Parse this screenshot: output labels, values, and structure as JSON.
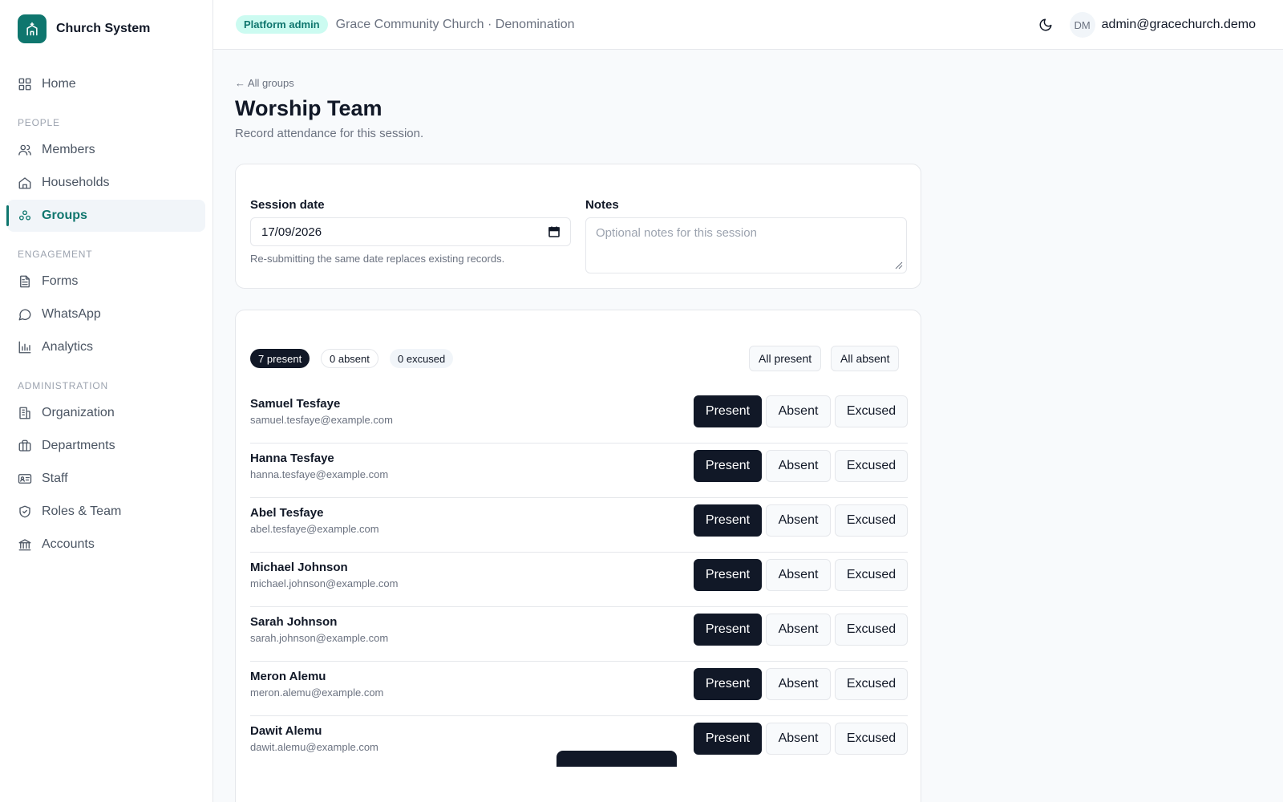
{
  "brand": {
    "name": "Church System",
    "icon": "church-icon"
  },
  "sidebar": {
    "items": [
      {
        "type": "item",
        "label": "Home",
        "icon": "grid-icon",
        "name": "sidebar-item-home"
      },
      {
        "type": "section",
        "label": "PEOPLE"
      },
      {
        "type": "item",
        "label": "Members",
        "icon": "users-icon",
        "name": "sidebar-item-members"
      },
      {
        "type": "item",
        "label": "Households",
        "icon": "house-icon",
        "name": "sidebar-item-households"
      },
      {
        "type": "item",
        "label": "Groups",
        "icon": "groups-icon",
        "name": "sidebar-item-groups",
        "active": true
      },
      {
        "type": "section",
        "label": "ENGAGEMENT"
      },
      {
        "type": "item",
        "label": "Forms",
        "icon": "document-icon",
        "name": "sidebar-item-forms"
      },
      {
        "type": "item",
        "label": "WhatsApp",
        "icon": "chat-icon",
        "name": "sidebar-item-whatsapp"
      },
      {
        "type": "item",
        "label": "Analytics",
        "icon": "bar-chart-icon",
        "name": "sidebar-item-analytics"
      },
      {
        "type": "section",
        "label": "ADMINISTRATION"
      },
      {
        "type": "item",
        "label": "Organization",
        "icon": "building-icon",
        "name": "sidebar-item-organization"
      },
      {
        "type": "item",
        "label": "Departments",
        "icon": "briefcase-icon",
        "name": "sidebar-item-departments"
      },
      {
        "type": "item",
        "label": "Staff",
        "icon": "id-card-icon",
        "name": "sidebar-item-staff"
      },
      {
        "type": "item",
        "label": "Roles & Team",
        "icon": "shield-icon",
        "name": "sidebar-item-roles-team"
      },
      {
        "type": "item",
        "label": "Accounts",
        "icon": "bank-icon",
        "name": "sidebar-item-accounts"
      }
    ]
  },
  "header": {
    "badge": "Platform admin",
    "org": "Grace Community Church · Denomination",
    "theme_icon": "moon-icon",
    "avatar_initials": "DM",
    "user_email": "admin@gracechurch.demo"
  },
  "page": {
    "back_link": "← All groups",
    "title": "Worship Team",
    "subtitle": "Record attendance for this session."
  },
  "session": {
    "date_label": "Session date",
    "date_value": "17/09/2026",
    "date_hint": "Re-submitting the same date replaces existing records.",
    "notes_label": "Notes",
    "notes_placeholder": "Optional notes for this session"
  },
  "attendance": {
    "counts": {
      "present": "7 present",
      "absent": "0 absent",
      "excused": "0 excused"
    },
    "bulk": {
      "all_present": "All present",
      "all_absent": "All absent"
    },
    "status_labels": {
      "present": "Present",
      "absent": "Absent",
      "excused": "Excused"
    },
    "members": [
      {
        "name": "Samuel Tesfaye",
        "email": "samuel.tesfaye@example.com",
        "status": "present"
      },
      {
        "name": "Hanna Tesfaye",
        "email": "hanna.tesfaye@example.com",
        "status": "present"
      },
      {
        "name": "Abel Tesfaye",
        "email": "abel.tesfaye@example.com",
        "status": "present"
      },
      {
        "name": "Michael Johnson",
        "email": "michael.johnson@example.com",
        "status": "present"
      },
      {
        "name": "Sarah Johnson",
        "email": "sarah.johnson@example.com",
        "status": "present"
      },
      {
        "name": "Meron Alemu",
        "email": "meron.alemu@example.com",
        "status": "present"
      },
      {
        "name": "Dawit Alemu",
        "email": "dawit.alemu@example.com",
        "status": "present"
      }
    ]
  },
  "colors": {
    "accent": "#0f766e",
    "accent_soft": "#ccfbf1",
    "dark": "#111827",
    "muted": "#6b7280",
    "border": "#e5e7eb"
  }
}
